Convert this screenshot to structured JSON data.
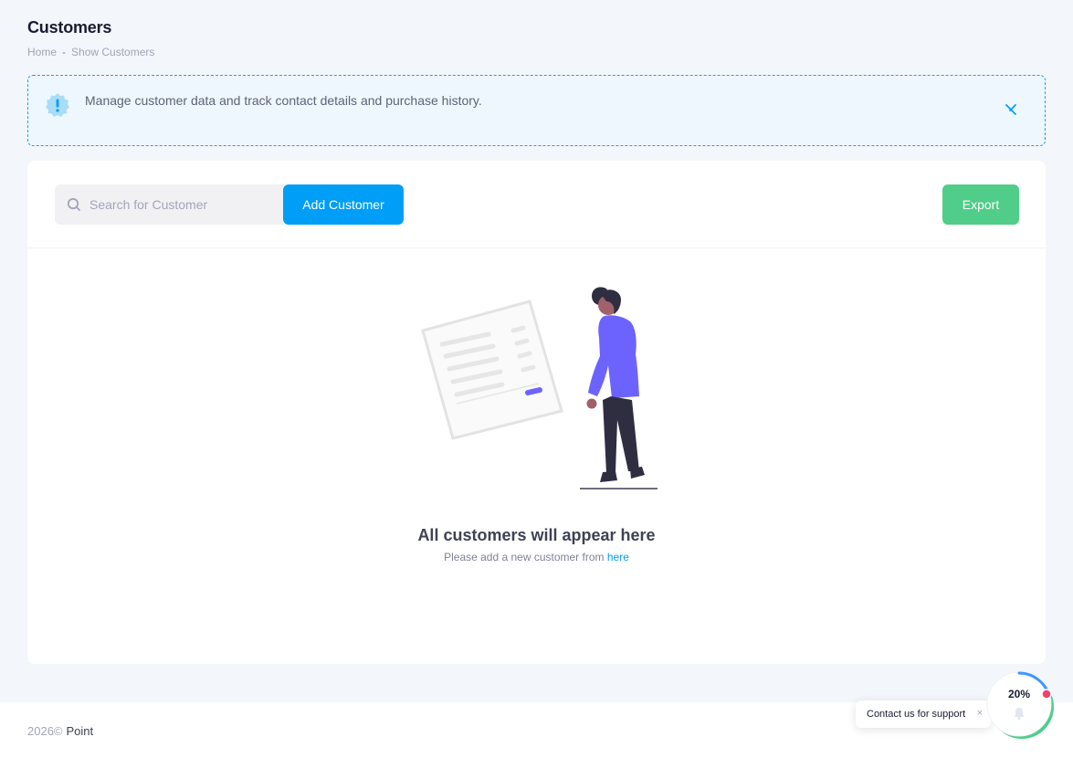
{
  "header": {
    "title": "Customers",
    "breadcrumb": [
      "Home",
      "Show Customers"
    ],
    "separator": "-"
  },
  "notice": {
    "icon": "alert-badge-icon",
    "text": "Manage customer data and track contact details and purchase history.",
    "close_icon": "close-icon",
    "accent": "#1ba4e6",
    "background": "#eef7fd"
  },
  "toolbar": {
    "search_placeholder": "Search for Customer",
    "search_value": "",
    "add_label": "Add Customer",
    "export_label": "Export",
    "add_color": "#009ef7",
    "export_color": "#50cd89"
  },
  "empty_state": {
    "title": "All customers will appear here",
    "subtitle": "Please add a new customer from",
    "link_text": "here"
  },
  "footer": {
    "year": "2026©",
    "brand": "Point"
  },
  "support": {
    "label": "Contact us for support",
    "close": "×",
    "progress_label": "20%",
    "progress_value": 0.2
  }
}
